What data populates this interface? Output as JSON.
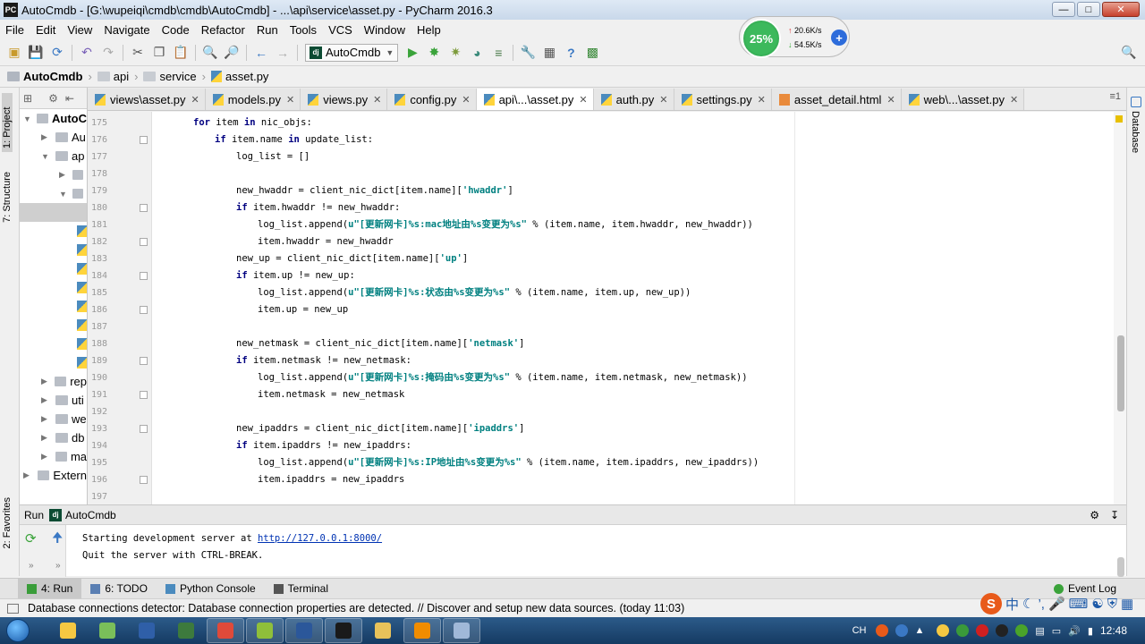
{
  "window": {
    "title": "AutoCmdb - [G:\\wupeiqi\\cmdb\\cmdb\\AutoCmdb] - ...\\api\\service\\asset.py - PyCharm 2016.3",
    "app_badge": "PC"
  },
  "menu": [
    "File",
    "Edit",
    "View",
    "Navigate",
    "Code",
    "Refactor",
    "Run",
    "Tools",
    "VCS",
    "Window",
    "Help"
  ],
  "toolbar": {
    "run_config": "AutoCmdb"
  },
  "breadcrumb": [
    "AutoCmdb",
    "api",
    "service",
    "asset.py"
  ],
  "side_tabs": {
    "project": "1: Project",
    "structure": "7: Structure",
    "favorites": "2: Favorites",
    "database": "Database"
  },
  "project_tree": [
    {
      "label": "AutoC",
      "level": 0
    },
    {
      "label": "Au",
      "level": 1
    },
    {
      "label": "ap",
      "level": 1
    },
    {
      "label": "",
      "level": 2
    },
    {
      "label": "",
      "level": 2
    },
    {
      "label": "rep",
      "level": 1
    },
    {
      "label": "uti",
      "level": 1
    },
    {
      "label": "we",
      "level": 1
    },
    {
      "label": "db",
      "level": 1
    },
    {
      "label": "ma",
      "level": 1
    },
    {
      "label": "Extern",
      "level": 0
    }
  ],
  "tabs": [
    {
      "label": "views\\asset.py",
      "active": false,
      "kind": "py"
    },
    {
      "label": "models.py",
      "active": false,
      "kind": "py"
    },
    {
      "label": "views.py",
      "active": false,
      "kind": "py"
    },
    {
      "label": "config.py",
      "active": false,
      "kind": "py"
    },
    {
      "label": "api\\...\\asset.py",
      "active": true,
      "kind": "py"
    },
    {
      "label": "auth.py",
      "active": false,
      "kind": "py"
    },
    {
      "label": "settings.py",
      "active": false,
      "kind": "py"
    },
    {
      "label": "asset_detail.html",
      "active": false,
      "kind": "html"
    },
    {
      "label": "web\\...\\asset.py",
      "active": false,
      "kind": "py"
    }
  ],
  "code_lines": [
    {
      "num": "175",
      "indent": 1,
      "parts": [
        [
          "kw",
          "for"
        ],
        [
          "",
          " item "
        ],
        [
          "kw",
          "in"
        ],
        [
          "",
          " nic_objs:"
        ]
      ]
    },
    {
      "num": "176",
      "indent": 2,
      "parts": [
        [
          "kw",
          "if"
        ],
        [
          "",
          " item.name "
        ],
        [
          "kw",
          "in"
        ],
        [
          "",
          " update_list:"
        ]
      ]
    },
    {
      "num": "177",
      "indent": 3,
      "parts": [
        [
          "",
          "log_list = []"
        ]
      ]
    },
    {
      "num": "178",
      "indent": 0,
      "parts": []
    },
    {
      "num": "179",
      "indent": 3,
      "parts": [
        [
          "",
          "new_hwaddr = client_nic_dict[item.name]["
        ],
        [
          "str",
          "'hwaddr'"
        ],
        [
          "",
          "]"
        ]
      ]
    },
    {
      "num": "180",
      "indent": 3,
      "parts": [
        [
          "kw",
          "if"
        ],
        [
          "",
          " item.hwaddr != new_hwaddr:"
        ]
      ]
    },
    {
      "num": "181",
      "indent": 4,
      "parts": [
        [
          "",
          "log_list.append("
        ],
        [
          "str",
          "u\"[更新网卡]%s:mac地址由%s变更为%s\""
        ],
        [
          "",
          " % (item.name, item.hwaddr, new_hwaddr))"
        ]
      ]
    },
    {
      "num": "182",
      "indent": 4,
      "parts": [
        [
          "",
          "item.hwaddr = new_hwaddr"
        ]
      ]
    },
    {
      "num": "183",
      "indent": 3,
      "parts": [
        [
          "",
          "new_up = client_nic_dict[item.name]["
        ],
        [
          "str",
          "'up'"
        ],
        [
          "",
          "]"
        ]
      ]
    },
    {
      "num": "184",
      "indent": 3,
      "parts": [
        [
          "kw",
          "if"
        ],
        [
          "",
          " item.up != new_up:"
        ]
      ]
    },
    {
      "num": "185",
      "indent": 4,
      "parts": [
        [
          "",
          "log_list.append("
        ],
        [
          "str",
          "u\"[更新网卡]%s:状态由%s变更为%s\""
        ],
        [
          "",
          " % (item.name, item.up, new_up))"
        ]
      ]
    },
    {
      "num": "186",
      "indent": 4,
      "parts": [
        [
          "",
          "item.up = new_up"
        ]
      ]
    },
    {
      "num": "187",
      "indent": 0,
      "parts": []
    },
    {
      "num": "188",
      "indent": 3,
      "parts": [
        [
          "",
          "new_netmask = client_nic_dict[item.name]["
        ],
        [
          "str",
          "'netmask'"
        ],
        [
          "",
          "]"
        ]
      ]
    },
    {
      "num": "189",
      "indent": 3,
      "parts": [
        [
          "kw",
          "if"
        ],
        [
          "",
          " item.netmask != new_netmask:"
        ]
      ]
    },
    {
      "num": "190",
      "indent": 4,
      "parts": [
        [
          "",
          "log_list.append("
        ],
        [
          "str",
          "u\"[更新网卡]%s:掩码由%s变更为%s\""
        ],
        [
          "",
          " % (item.name, item.netmask, new_netmask))"
        ]
      ]
    },
    {
      "num": "191",
      "indent": 4,
      "parts": [
        [
          "",
          "item.netmask = new_netmask"
        ]
      ]
    },
    {
      "num": "192",
      "indent": 0,
      "parts": []
    },
    {
      "num": "193",
      "indent": 3,
      "parts": [
        [
          "",
          "new_ipaddrs = client_nic_dict[item.name]["
        ],
        [
          "str",
          "'ipaddrs'"
        ],
        [
          "",
          "]"
        ]
      ]
    },
    {
      "num": "194",
      "indent": 3,
      "parts": [
        [
          "kw",
          "if"
        ],
        [
          "",
          " item.ipaddrs != new_ipaddrs:"
        ]
      ]
    },
    {
      "num": "195",
      "indent": 4,
      "parts": [
        [
          "",
          "log_list.append("
        ],
        [
          "str",
          "u\"[更新网卡]%s:IP地址由%s变更为%s\""
        ],
        [
          "",
          " % (item.name, item.ipaddrs, new_ipaddrs))"
        ]
      ]
    },
    {
      "num": "196",
      "indent": 4,
      "parts": [
        [
          "",
          "item.ipaddrs = new_ipaddrs"
        ]
      ]
    },
    {
      "num": "197",
      "indent": 0,
      "parts": []
    }
  ],
  "run_panel": {
    "label": "Run",
    "config": "AutoCmdb",
    "line1_prefix": "Starting development server at ",
    "line1_link": "http://127.0.0.1:8000/",
    "line2": "Quit the server with CTRL-BREAK."
  },
  "bottom_tabs": [
    {
      "label": "4: Run",
      "active": true,
      "color": "#3a9d3a"
    },
    {
      "label": "6: TODO",
      "active": false,
      "color": "#5a7fb3"
    },
    {
      "label": "Python Console",
      "active": false,
      "color": "#4b8bbe"
    },
    {
      "label": "Terminal",
      "active": false,
      "color": "#555555"
    }
  ],
  "event_log": "Event Log",
  "status_message": "Database connections detector: Database connection properties are detected. // Discover and setup new data sources. (today 11:03)",
  "net_widget": {
    "percent": "25%",
    "up": "20.6K/s",
    "down": "54.5K/s"
  },
  "ime": {
    "logo": "S",
    "lang": "中"
  },
  "tray": {
    "lang": "CH",
    "time": "12:48"
  },
  "taskbar_apps": [
    {
      "color": "#f5c842",
      "open": false
    },
    {
      "color": "#7abf5a",
      "open": false
    },
    {
      "color": "#2f5fa8",
      "open": false
    },
    {
      "color": "#3d7a3d",
      "open": false
    },
    {
      "color": "#e04a3a",
      "open": true
    },
    {
      "color": "#8fbf3a",
      "open": true
    },
    {
      "color": "#2b579a",
      "open": true
    },
    {
      "color": "#1a1a1a",
      "open": true
    },
    {
      "color": "#e8c25a",
      "open": false
    },
    {
      "color": "#f08c00",
      "open": true
    },
    {
      "color": "#a0b8d8",
      "open": true
    }
  ]
}
